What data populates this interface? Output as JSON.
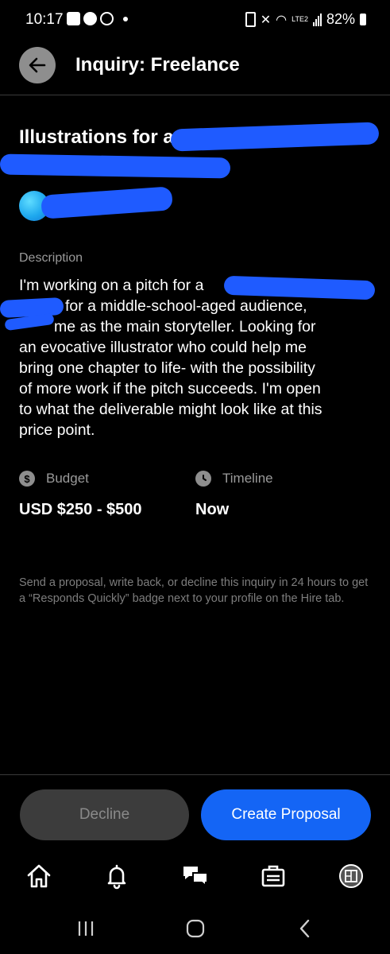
{
  "status_bar": {
    "time": "10:17",
    "lte_label": "LTE2",
    "battery": "82%"
  },
  "header": {
    "title": "Inquiry: Freelance"
  },
  "inquiry": {
    "title_visible": "Illustrations for a",
    "description_label": "Description",
    "description_lines": [
      "I'm working on a pitch for a",
      "for a middle-school-aged audience,",
      "me as the main storyteller. Looking for",
      "an evocative illustrator who could help me",
      "bring one chapter to life- with the possibility",
      "of more work if the pitch succeeds. I'm open",
      "to what the deliverable might look like at this",
      "price point."
    ],
    "budget_label": "Budget",
    "budget_value": "USD $250 - $500",
    "timeline_label": "Timeline",
    "timeline_value": "Now",
    "note": "Send a proposal, write back, or decline this inquiry in 24 hours to get a “Responds Quickly” badge next to your profile on the Hire tab."
  },
  "actions": {
    "decline_label": "Decline",
    "create_label": "Create Proposal"
  },
  "tabs": [
    {
      "icon": "home-icon"
    },
    {
      "icon": "bell-icon"
    },
    {
      "icon": "chat-icon"
    },
    {
      "icon": "briefcase-icon"
    },
    {
      "icon": "portfolio-icon"
    }
  ],
  "colors": {
    "accent": "#1465f5",
    "redaction": "#1f5bff",
    "muted": "#9a9a9a"
  }
}
